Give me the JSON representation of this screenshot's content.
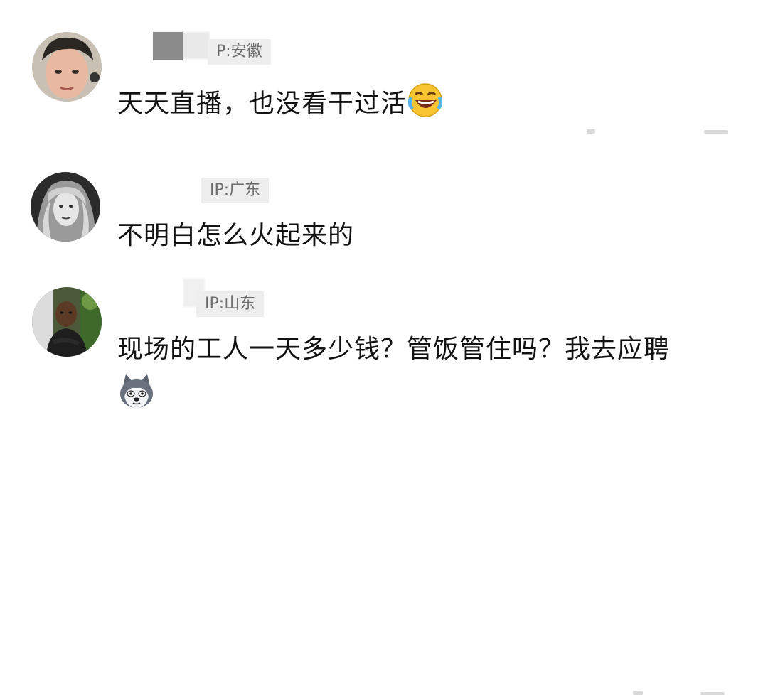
{
  "comments": [
    {
      "ip": "P:安徽",
      "text": "天天直播，也没看干过活",
      "emoji": "rofl-emoji"
    },
    {
      "ip": "IP:广东",
      "text": "不明白怎么火起来的"
    },
    {
      "ip": "IP:山东",
      "text": "现场的工人一天多少钱？管饭管住吗？我去应聘",
      "emoji": "husky-emoji"
    }
  ]
}
